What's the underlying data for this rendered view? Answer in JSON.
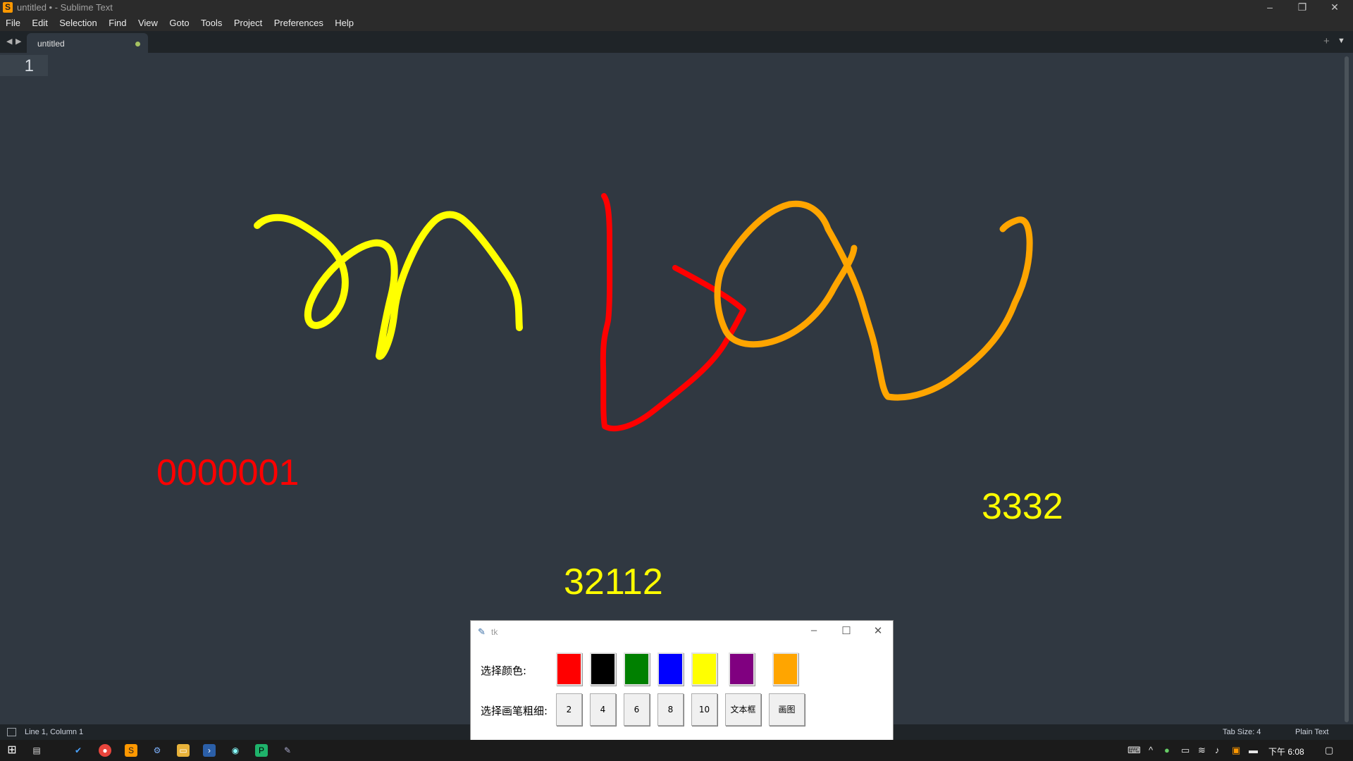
{
  "window": {
    "title": "untitled • - Sublime Text",
    "controls": {
      "minimize": "–",
      "restore": "❐",
      "close": "✕"
    }
  },
  "menubar": [
    "File",
    "Edit",
    "Selection",
    "Find",
    "View",
    "Goto",
    "Tools",
    "Project",
    "Preferences",
    "Help"
  ],
  "tabs": [
    {
      "label": "untitled",
      "dirty": true
    }
  ],
  "editor": {
    "line_numbers": [
      "1"
    ]
  },
  "canvas": {
    "texts": [
      {
        "text": "0000001",
        "color": "#ff0000"
      },
      {
        "text": "3332",
        "color": "#ffff00"
      },
      {
        "text": "32112",
        "color": "#ffff00"
      }
    ],
    "stroke_colors": {
      "yellow": "#ffff00",
      "red": "#ff0000",
      "orange": "#ffa500"
    }
  },
  "statusbar": {
    "position": "Line 1, Column 1",
    "tab_size": "Tab Size: 4",
    "syntax": "Plain Text"
  },
  "tk_window": {
    "title": "tk",
    "color_label": "选择颜色:",
    "width_label": "选择画笔粗细:",
    "colors": [
      "#ff0000",
      "#000000",
      "#008000",
      "#0000ff",
      "#ffff00",
      "#800080",
      "#ffa500"
    ],
    "size_buttons": [
      "2",
      "4",
      "6",
      "8",
      "10",
      "文本框",
      "画图"
    ]
  },
  "taskbar": {
    "clock": "下午 6:08"
  }
}
